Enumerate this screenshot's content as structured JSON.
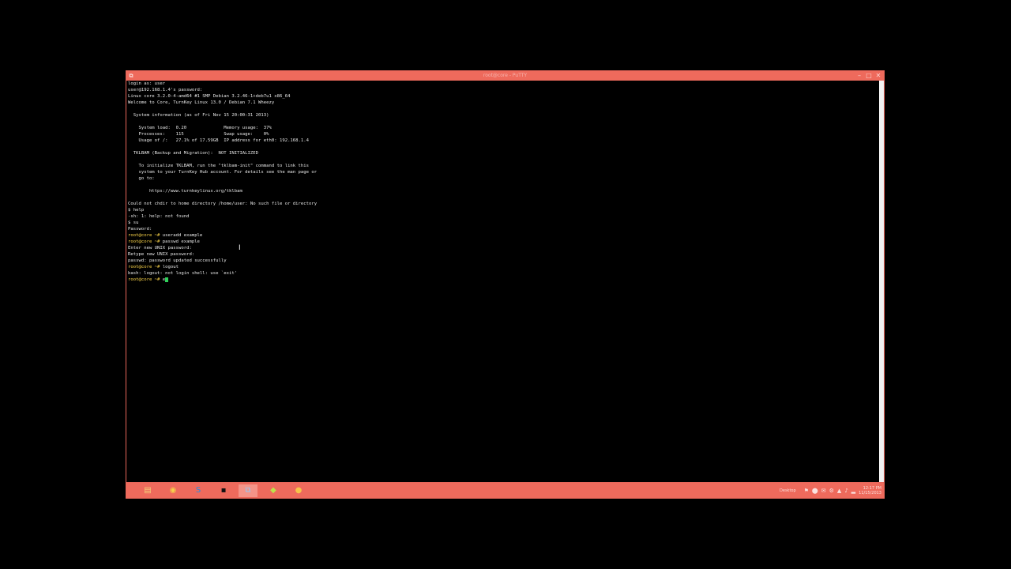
{
  "window": {
    "title": "root@core - PuTTY",
    "icon": "putty-icon",
    "controls": {
      "minimize": "–",
      "maximize": "□",
      "close": "✕"
    }
  },
  "terminal": {
    "lines": [
      "login as: user",
      "user@192.168.1.4's password:",
      "Linux core 3.2.0-4-amd64 #1 SMP Debian 3.2.46-1+deb7u1 x86_64",
      "Welcome to Core, TurnKey Linux 13.0 / Debian 7.1 Wheezy",
      "",
      "  System information (as of Fri Nov 15 20:00:31 2013)",
      "",
      "    System load:  0.20              Memory usage:  37%",
      "    Processes:    115               Swap usage:    0%",
      "    Usage of /:   27.1% of 17.59GB  IP address for eth0: 192.168.1.4",
      "",
      "  TKLBAM (Backup and Migration):  NOT INITIALIZED",
      "",
      "    To initialize TKLBAM, run the \"tklbam-init\" command to link this",
      "    system to your TurnKey Hub account. For details see the man page or",
      "    go to:",
      "",
      "        https://www.turnkeylinux.org/tklbam",
      "",
      "Could not chdir to home directory /home/user: No such file or directory",
      "$ help",
      "-sh: 1: help: not found",
      "$ su",
      "Password:"
    ],
    "session": [
      {
        "prompt": "root@core ~# ",
        "command": "useradd example"
      },
      {
        "prompt": "root@core ~# ",
        "command": "passwd example"
      },
      {
        "prompt": "",
        "command": "Enter new UNIX password:"
      },
      {
        "prompt": "",
        "command": "Retype new UNIX password:"
      },
      {
        "prompt": "",
        "command": "passwd: password updated successfully"
      },
      {
        "prompt": "root@core ~# ",
        "command": "logout"
      },
      {
        "prompt": "",
        "command": "bash: logout: not login shell: use `exit'"
      }
    ],
    "current_prompt": "root@core ~# ",
    "current_input": "e"
  },
  "taskbar": {
    "apps": [
      {
        "name": "file-explorer",
        "icon": "▤"
      },
      {
        "name": "chrome",
        "icon": "◉"
      },
      {
        "name": "skype",
        "icon": "S"
      },
      {
        "name": "command-prompt",
        "icon": "▪"
      },
      {
        "name": "putty",
        "icon": "⧉"
      },
      {
        "name": "app-6",
        "icon": "◆"
      },
      {
        "name": "app-7",
        "icon": "●"
      }
    ],
    "tray": {
      "desktop_label": "Desktop",
      "icons": [
        "⚑",
        "⬤",
        "✉",
        "⚙",
        "▲",
        "♪",
        "▂"
      ],
      "time": "12:17 PM",
      "date": "11/15/2013"
    }
  },
  "colors": {
    "titlebar": "#ee6a5c",
    "taskbar": "#ee6a5c",
    "prompt": "#ffd84a",
    "cursor": "#2fd15a"
  }
}
